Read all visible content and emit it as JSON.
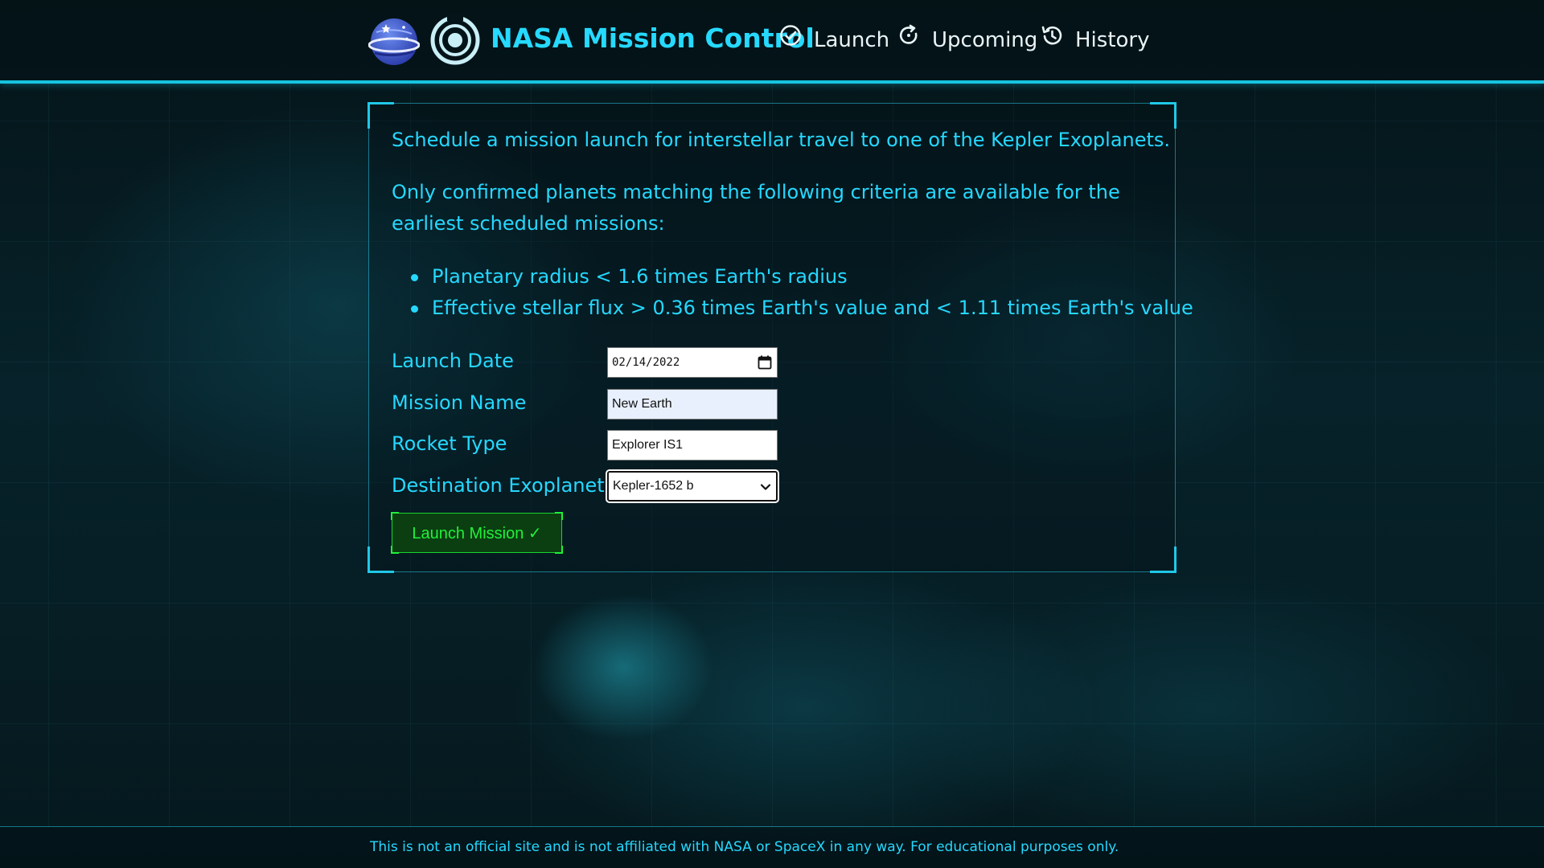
{
  "header": {
    "title": "NASA Mission Control",
    "nav": [
      {
        "label": "Launch",
        "icon": "check-circle-icon"
      },
      {
        "label": "Upcoming",
        "icon": "refresh-icon"
      },
      {
        "label": "History",
        "icon": "history-icon"
      }
    ]
  },
  "intro": {
    "paragraph1": "Schedule a mission launch for interstellar travel to one of the Kepler Exoplanets.",
    "paragraph2": "Only confirmed planets matching the following criteria are available for the earliest scheduled missions:",
    "criteria": [
      "Planetary radius < 1.6 times Earth's radius",
      "Effective stellar flux > 0.36 times Earth's value and < 1.11 times Earth's value"
    ]
  },
  "form": {
    "launch_date": {
      "label": "Launch Date",
      "value": "02/14/2022"
    },
    "mission_name": {
      "label": "Mission Name",
      "value": "New Earth"
    },
    "rocket_type": {
      "label": "Rocket Type",
      "value": "Explorer IS1"
    },
    "destination": {
      "label": "Destination Exoplanet",
      "value": "Kepler-1652 b"
    },
    "submit_label": "Launch Mission ✓"
  },
  "footer": {
    "text": "This is not an official site and is not affiliated with NASA or SpaceX in any way. For educational purposes only."
  },
  "colors": {
    "accent": "#26d8ff",
    "header_border": "#16c4e0",
    "button_green": "#21f03a",
    "button_bg": "#0b3f12"
  }
}
